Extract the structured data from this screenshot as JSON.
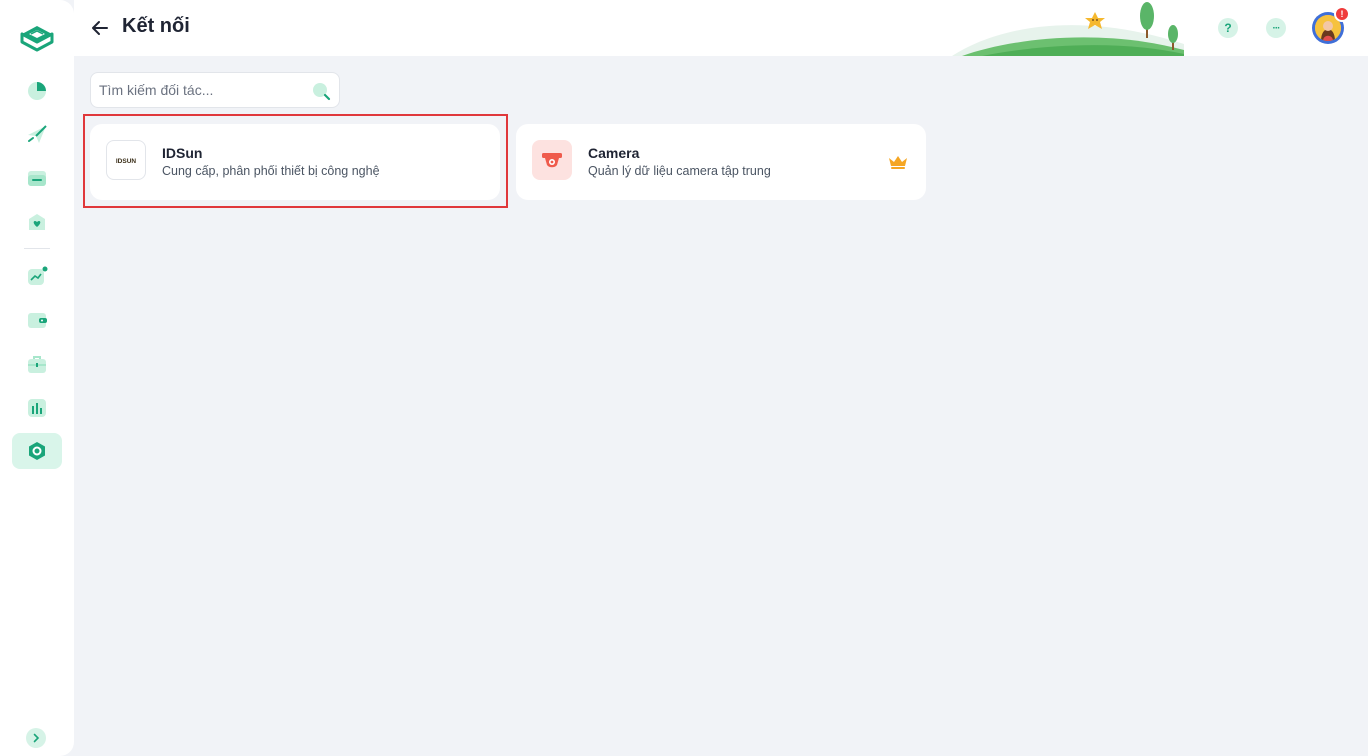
{
  "header": {
    "title": "Kết nối",
    "help_label": "?",
    "more_label": "···",
    "notification_count": "!"
  },
  "search": {
    "placeholder": "Tìm kiếm đối tác..."
  },
  "partners": [
    {
      "name": "IDSun",
      "description": "Cung cấp, phân phối thiết bị công nghệ",
      "logo_text": "IDSUN",
      "icon": "idsun-logo"
    },
    {
      "name": "Camera",
      "description": "Quản lý dữ liệu camera tập trung",
      "icon": "camera-icon",
      "badge_icon": "crown-icon"
    }
  ],
  "sidebar": {
    "items": [
      {
        "icon": "pie-chart-icon"
      },
      {
        "icon": "paper-plane-icon"
      },
      {
        "icon": "folder-icon"
      },
      {
        "icon": "heart-box-icon"
      },
      {
        "icon": "trend-chart-icon"
      },
      {
        "icon": "wallet-icon"
      },
      {
        "icon": "briefcase-icon"
      },
      {
        "icon": "bar-chart-icon"
      },
      {
        "icon": "hexagon-settings-icon",
        "active": true
      }
    ]
  },
  "colors": {
    "accent": "#1aa57a",
    "accent_light": "#d6f3e7",
    "highlight_border": "#e0383b",
    "camera_bg": "#fde2e0",
    "camera_fg": "#ef5b4c",
    "crown": "#f5a623"
  }
}
